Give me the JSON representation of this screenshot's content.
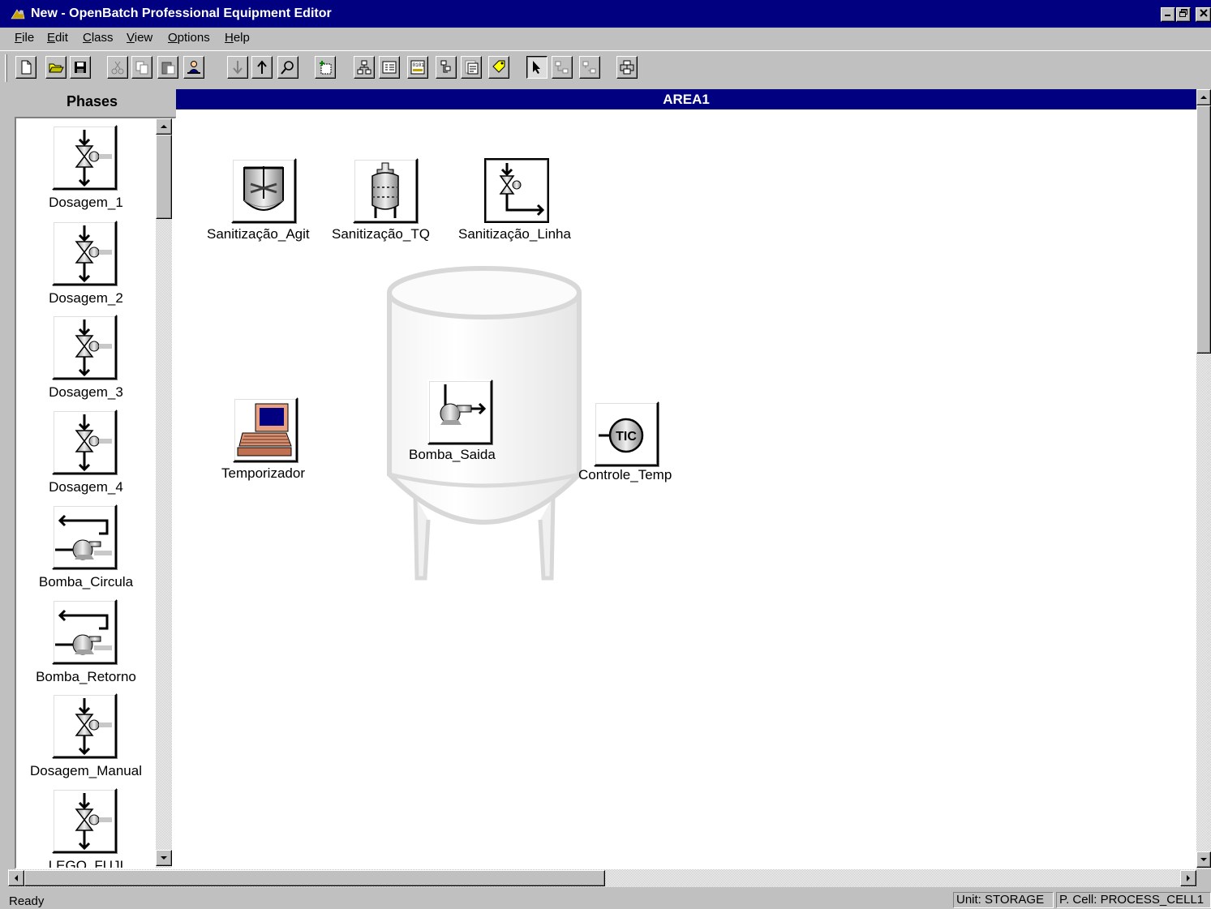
{
  "window": {
    "title": "New - OpenBatch Professional Equipment Editor",
    "controls": [
      "_",
      "🗗",
      "×"
    ]
  },
  "menu": [
    "File",
    "Edit",
    "Class",
    "View",
    "Options",
    "Help"
  ],
  "menu_underline": [
    "F",
    "E",
    "C",
    "V",
    "O",
    "H"
  ],
  "toolbar": {
    "buttons": [
      "new",
      "open",
      "save",
      "cut",
      "copy",
      "paste",
      "properties",
      "move-down",
      "move-up",
      "find",
      "add-unit",
      "hierarchy",
      "list-view",
      "binary",
      "tag",
      "report",
      "label",
      "select",
      "connect",
      "disconnect",
      "print"
    ]
  },
  "phases_panel": {
    "header": "Phases",
    "items": [
      {
        "label": "Dosagem_1",
        "icon": "valve-icon"
      },
      {
        "label": "Dosagem_2",
        "icon": "valve-icon"
      },
      {
        "label": "Dosagem_3",
        "icon": "valve-icon"
      },
      {
        "label": "Dosagem_4",
        "icon": "valve-icon"
      },
      {
        "label": "Bomba_Circula",
        "icon": "pump-recirculation-icon"
      },
      {
        "label": "Bomba_Retorno",
        "icon": "pump-recirculation-icon"
      },
      {
        "label": "Dosagem_Manual",
        "icon": "valve-icon"
      },
      {
        "label": "LEGO_FUJI",
        "icon": "valve-icon"
      }
    ]
  },
  "canvas": {
    "header": "AREA1",
    "equipment": [
      {
        "label": "Sanitização_Agit",
        "icon": "agitator-tank-icon"
      },
      {
        "label": "Sanitização_TQ",
        "icon": "spray-tank-icon"
      },
      {
        "label": "Sanitização_Linha",
        "icon": "valve-line-icon"
      },
      {
        "label": "Temporizador",
        "icon": "computer-timer-icon"
      },
      {
        "label": "Bomba_Saida",
        "icon": "pump-outlet-icon"
      },
      {
        "label": "Controle_Temp",
        "icon": "tic-controller-icon"
      }
    ]
  },
  "status": {
    "left": "Ready",
    "unit": "Unit: STORAGE",
    "cell": "P. Cell: PROCESS_CELL1"
  }
}
